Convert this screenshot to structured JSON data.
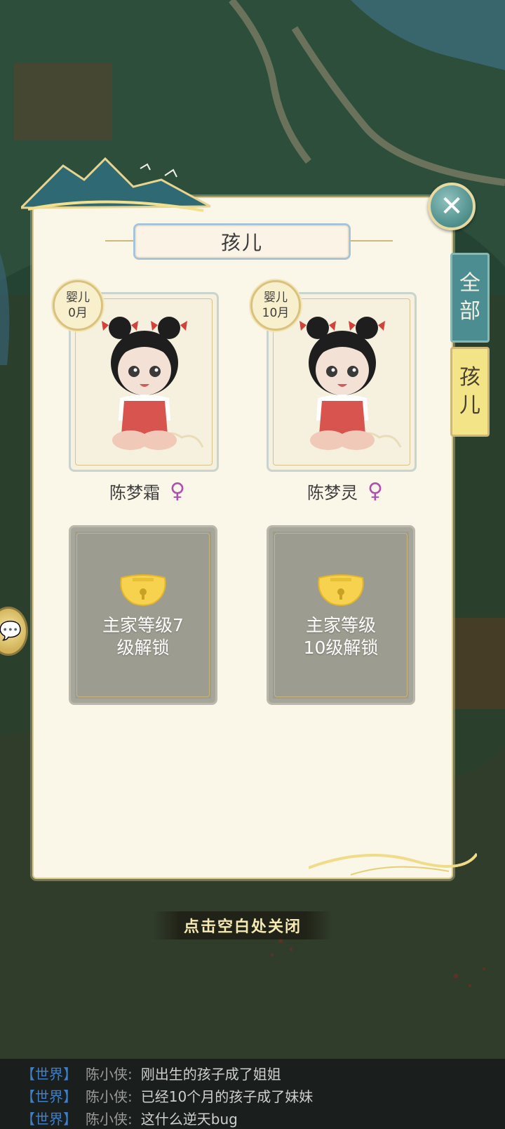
{
  "dialog": {
    "title": "孩儿",
    "close_icon": "close-x-icon"
  },
  "tabs": [
    {
      "label_line1": "全",
      "label_line2": "部",
      "selected": false
    },
    {
      "label_line1": "孩",
      "label_line2": "儿",
      "selected": true
    }
  ],
  "children": [
    {
      "badge_stage": "婴儿",
      "badge_age": "0月",
      "name": "陈梦霜",
      "gender_symbol": "♀"
    },
    {
      "badge_stage": "婴儿",
      "badge_age": "10月",
      "name": "陈梦灵",
      "gender_symbol": "♀"
    }
  ],
  "locked_slots": [
    {
      "line1": "主家等级7",
      "line2": "级解锁"
    },
    {
      "line1": "主家等级",
      "line2": "10级解锁"
    }
  ],
  "hint": "点击空白处关闭",
  "chat": [
    {
      "channel": "【世界】",
      "user": "陈小侠:",
      "message": "刚出生的孩子成了姐姐"
    },
    {
      "channel": "【世界】",
      "user": "陈小侠:",
      "message": "已经10个月的孩子成了妹妹"
    },
    {
      "channel": "【世界】",
      "user": "陈小侠:",
      "message": "这什么逆天bug"
    }
  ],
  "colors": {
    "panel_bg": "#faf6e8",
    "tab_selected": "#f4e488",
    "tab_unselected": "#4c8d92",
    "gender_female": "#b04fb2",
    "chat_channel": "#3f7fc8"
  }
}
